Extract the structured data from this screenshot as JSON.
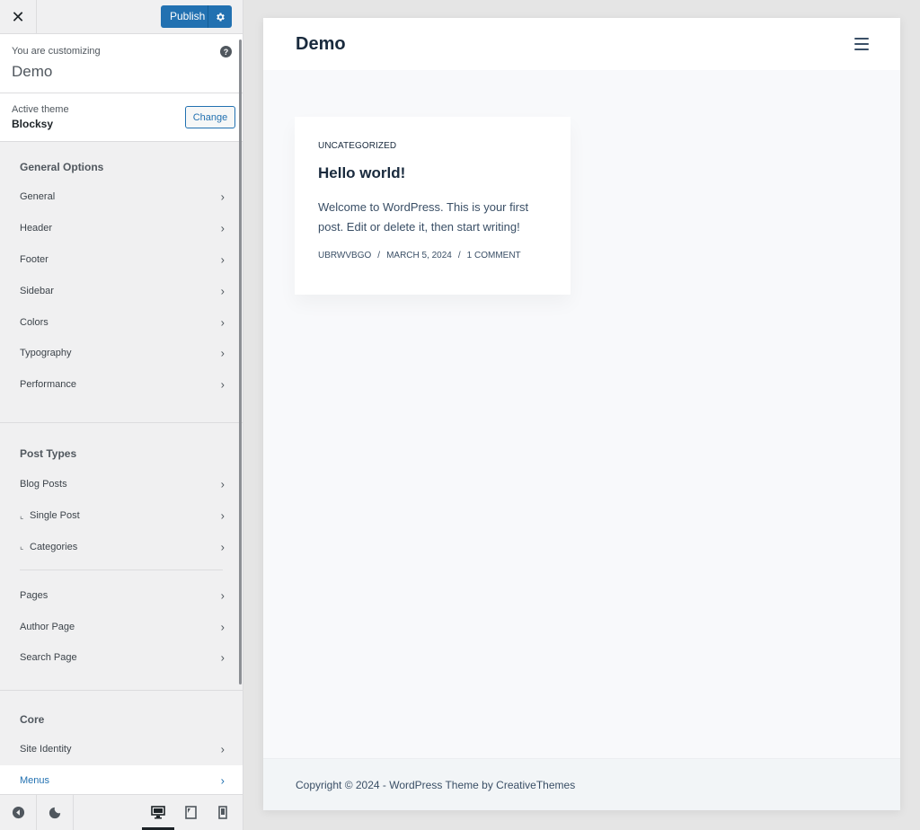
{
  "topbar": {
    "close_label": "✕",
    "publish_label": "Publish"
  },
  "customizing": {
    "label": "You are customizing",
    "site": "Demo",
    "help": "?"
  },
  "theme": {
    "label": "Active theme",
    "name": "Blocksy",
    "change_label": "Change"
  },
  "groups": {
    "general": {
      "title": "General Options",
      "items": [
        "General",
        "Header",
        "Footer",
        "Sidebar",
        "Colors",
        "Typography",
        "Performance"
      ]
    },
    "post_types": {
      "title": "Post Types",
      "items": [
        "Blog Posts",
        "Single Post",
        "Categories",
        "Pages",
        "Author Page",
        "Search Page"
      ]
    },
    "core": {
      "title": "Core",
      "items": [
        "Site Identity",
        "Menus"
      ]
    }
  },
  "sub_marker": "⌞",
  "chevron": "›",
  "footer_bar": {
    "selected_device": "desktop"
  },
  "preview": {
    "site_title": "Demo",
    "post": {
      "category": "UNCATEGORIZED",
      "title": "Hello world!",
      "excerpt": "Welcome to WordPress. This is your first post. Edit or delete it, then start writing!",
      "author": "UBRWVBGO",
      "date": "MARCH 5, 2024",
      "comments": "1 COMMENT",
      "separator": "/"
    },
    "copyright": "Copyright © 2024 - WordPress Theme by CreativeThemes"
  },
  "colors": {
    "accent": "#2271b1",
    "sidebar_bg": "#f0f0f1",
    "preview_bg": "#f8f9fb",
    "heading": "#192a3d"
  }
}
